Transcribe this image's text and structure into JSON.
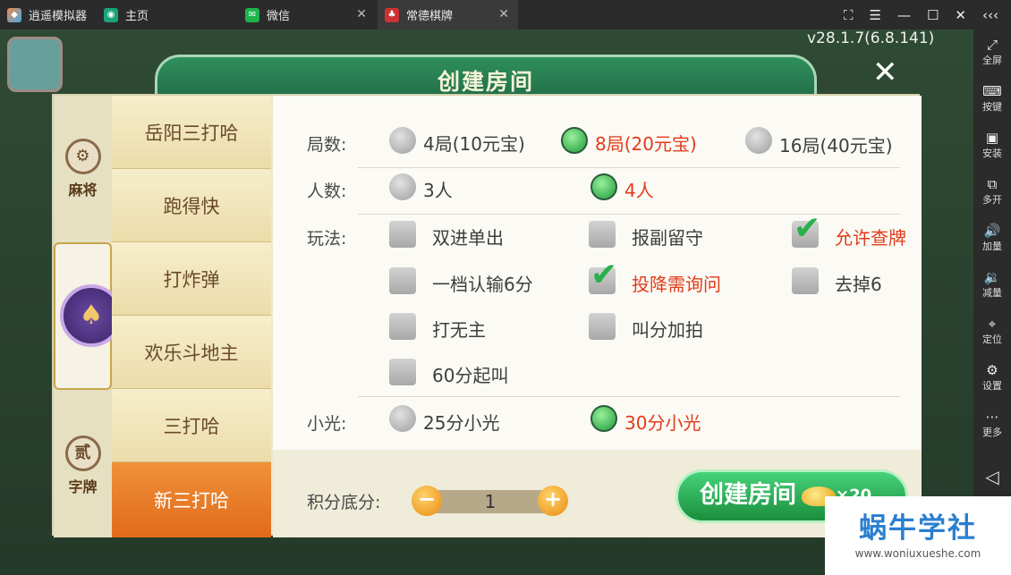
{
  "titlebar": {
    "app_name": "逍遥模拟器",
    "tabs": [
      {
        "label": "主页"
      },
      {
        "label": "微信"
      },
      {
        "label": "常德棋牌"
      }
    ]
  },
  "sidebar": {
    "items": [
      {
        "icon": "fullscreen-icon",
        "label": "全屏"
      },
      {
        "icon": "keyboard-icon",
        "label": "按键"
      },
      {
        "icon": "apk-icon",
        "label": "安装"
      },
      {
        "icon": "multi-open-icon",
        "label": "多开"
      },
      {
        "icon": "volume-up-icon",
        "label": "加量"
      },
      {
        "icon": "volume-down-icon",
        "label": "减量"
      },
      {
        "icon": "location-icon",
        "label": "定位"
      },
      {
        "icon": "gear-icon",
        "label": "设置"
      },
      {
        "icon": "more-icon",
        "label": "更多"
      }
    ]
  },
  "game": {
    "version": "v28.1.7(6.8.141)"
  },
  "dialog": {
    "title": "创建房间",
    "close_glyph": "✕",
    "categories": [
      {
        "label": "麻将",
        "glyph": "⚙"
      },
      {
        "label": "♠",
        "glyph": "♠"
      },
      {
        "label": "字牌",
        "glyph": "贰"
      }
    ],
    "games": [
      "岳阳三打哈",
      "跑得快",
      "打炸弹",
      "欢乐斗地主",
      "三打哈",
      "新三打哈"
    ],
    "selected_game": "新三打哈",
    "rounds": {
      "label": "局数:",
      "options": [
        "4局(10元宝)",
        "8局(20元宝)",
        "16局(40元宝)"
      ],
      "selected": "8局(20元宝)"
    },
    "players": {
      "label": "人数:",
      "options": [
        "3人",
        "4人"
      ],
      "selected": "4人"
    },
    "rules": {
      "label": "玩法:",
      "options": [
        {
          "text": "双进单出",
          "checked": false
        },
        {
          "text": "报副留守",
          "checked": false
        },
        {
          "text": "允许查牌",
          "checked": true
        },
        {
          "text": "一档认输6分",
          "checked": false
        },
        {
          "text": "投降需询问",
          "checked": true
        },
        {
          "text": "去掉6",
          "checked": false
        },
        {
          "text": "打无主",
          "checked": false
        },
        {
          "text": "叫分加拍",
          "checked": false
        },
        {
          "text": "60分起叫",
          "checked": false
        }
      ]
    },
    "xiaoguang": {
      "label": "小光:",
      "options": [
        "25分小光",
        "30分小光"
      ],
      "selected": "30分小光"
    },
    "score": {
      "label": "积分底分:",
      "value": "1",
      "minus": "−",
      "plus": "+"
    },
    "create_button": {
      "label": "创建房间",
      "cost": "×20"
    }
  },
  "watermark": {
    "line1": "蜗牛学社",
    "line2": "www.woniuxueshe.com"
  },
  "colors": {
    "selected_text": "#e23b1a",
    "accent_green": "#1b8e3c",
    "header": "#2f8f5c"
  }
}
